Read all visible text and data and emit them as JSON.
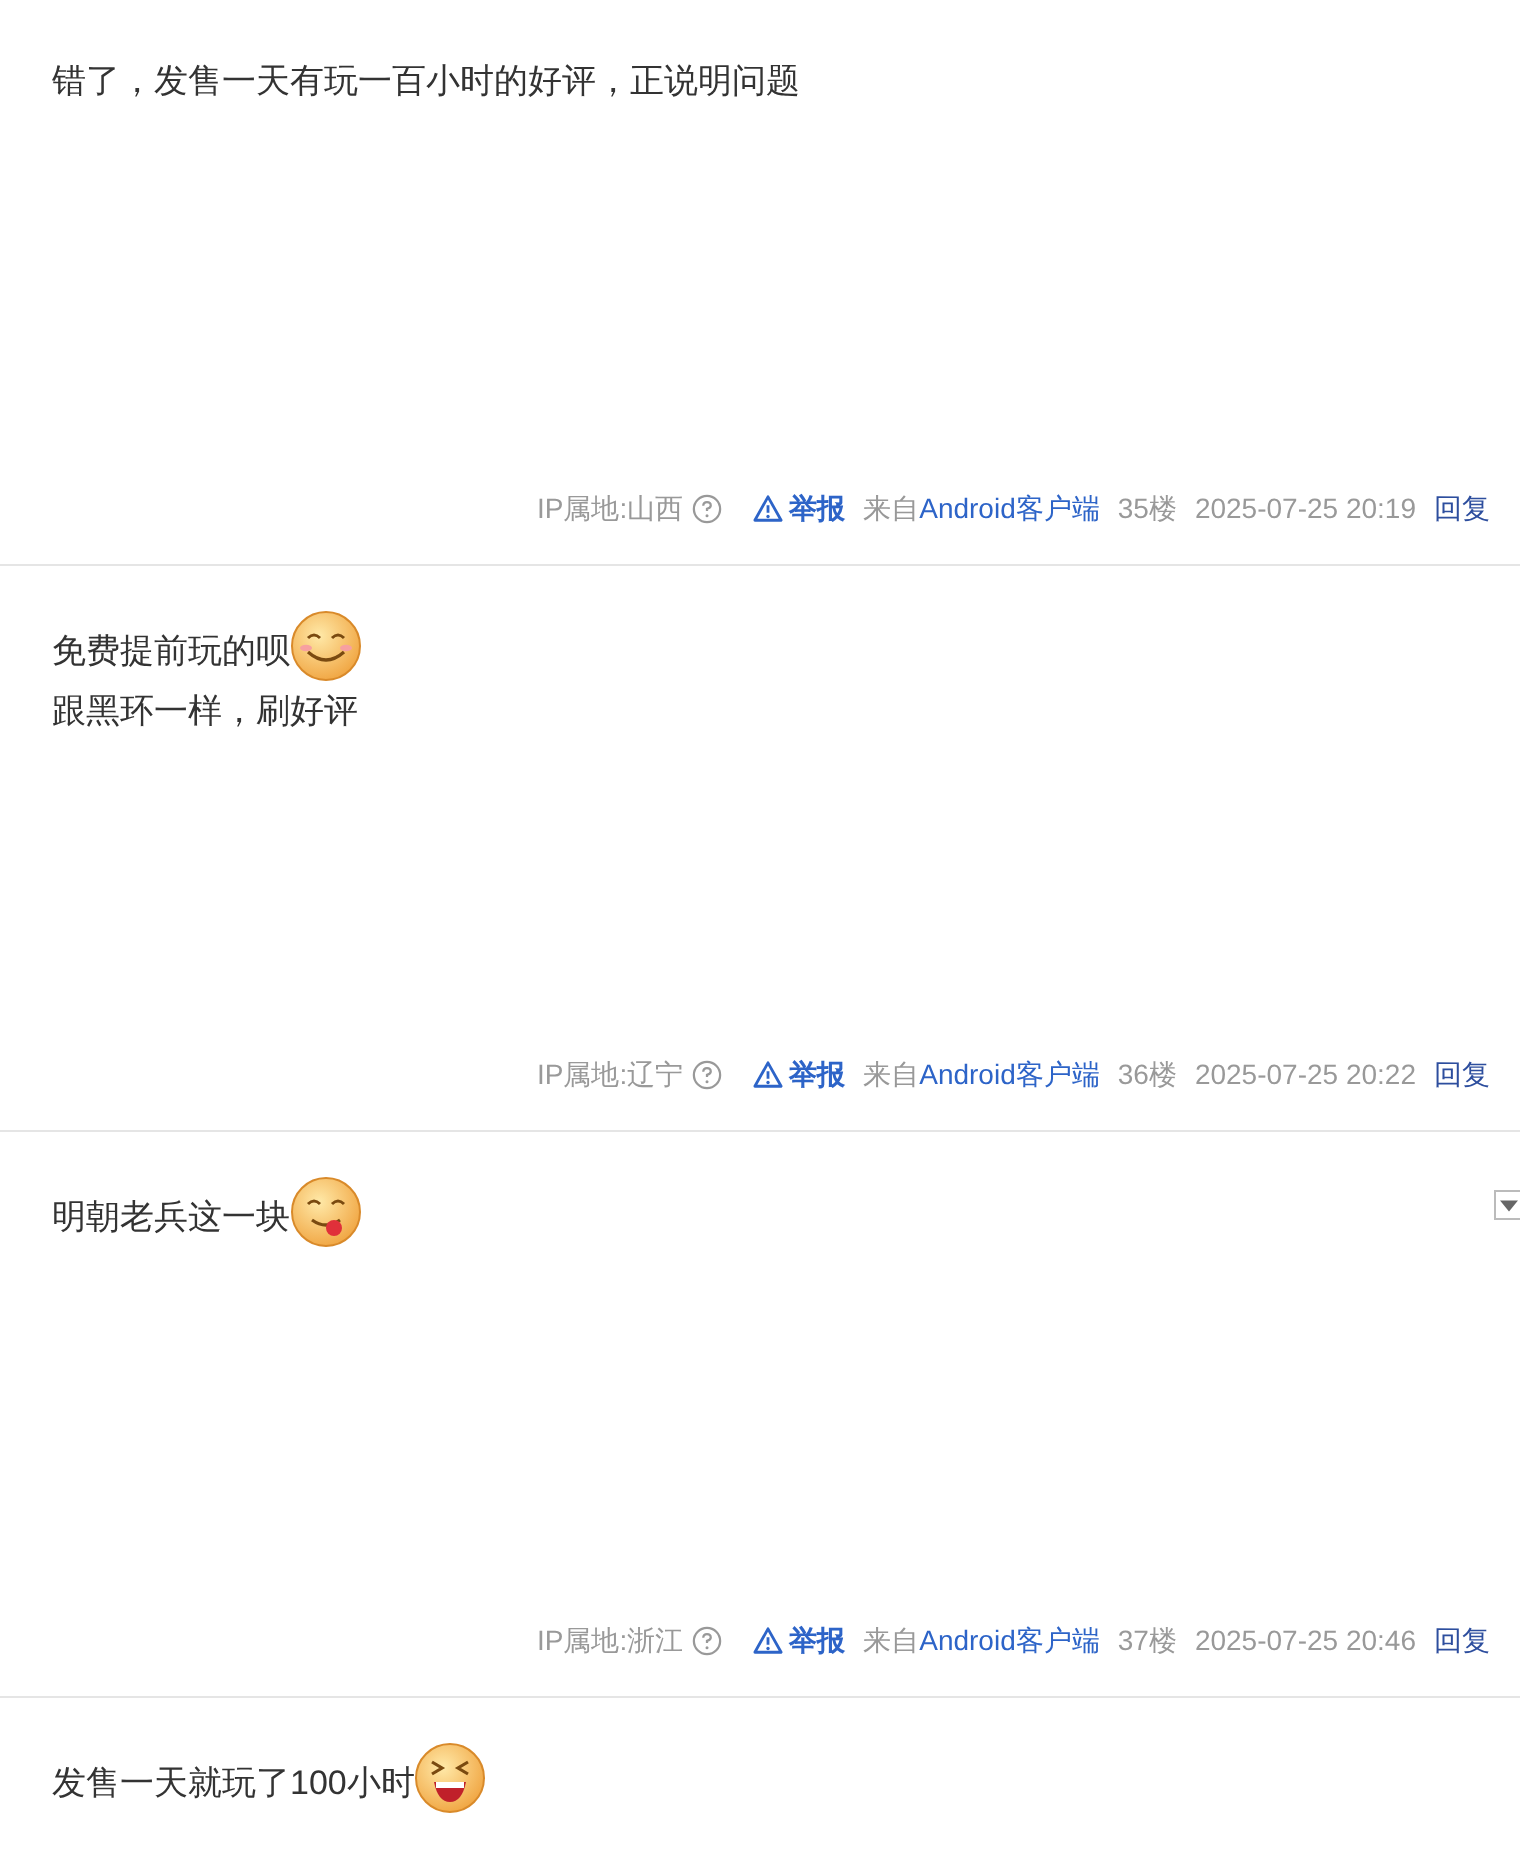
{
  "posts": [
    {
      "lines": [
        {
          "text": "错了，发售一天有玩一百小时的好评，正说明问题"
        }
      ],
      "has_menu": false,
      "footer": {
        "ip": "IP属地:山西",
        "report": "举报",
        "source_prefix": "来自",
        "source": "Android客户端",
        "floor": "35楼",
        "time": "2025-07-25 20:19",
        "reply": "回复"
      }
    },
    {
      "lines": [
        {
          "text": "免费提前玩的呗",
          "emoji": {
            "kind": "smile"
          }
        },
        {
          "text": "跟黑环一样，刷好评"
        }
      ],
      "has_menu": false,
      "footer": {
        "ip": "IP属地:辽宁",
        "report": "举报",
        "source_prefix": "来自",
        "source": "Android客户端",
        "floor": "36楼",
        "time": "2025-07-25 20:22",
        "reply": "回复"
      }
    },
    {
      "lines": [
        {
          "text": "明朝老兵这一块",
          "emoji": {
            "kind": "tongue"
          }
        }
      ],
      "has_menu": true,
      "footer": {
        "ip": "IP属地:浙江",
        "report": "举报",
        "source_prefix": "来自",
        "source": "Android客户端",
        "floor": "37楼",
        "time": "2025-07-25 20:46",
        "reply": "回复"
      }
    },
    {
      "lines": [
        {
          "text": "发售一天就玩了100小时",
          "emoji": {
            "kind": "grin"
          }
        }
      ],
      "has_menu": false
    }
  ]
}
